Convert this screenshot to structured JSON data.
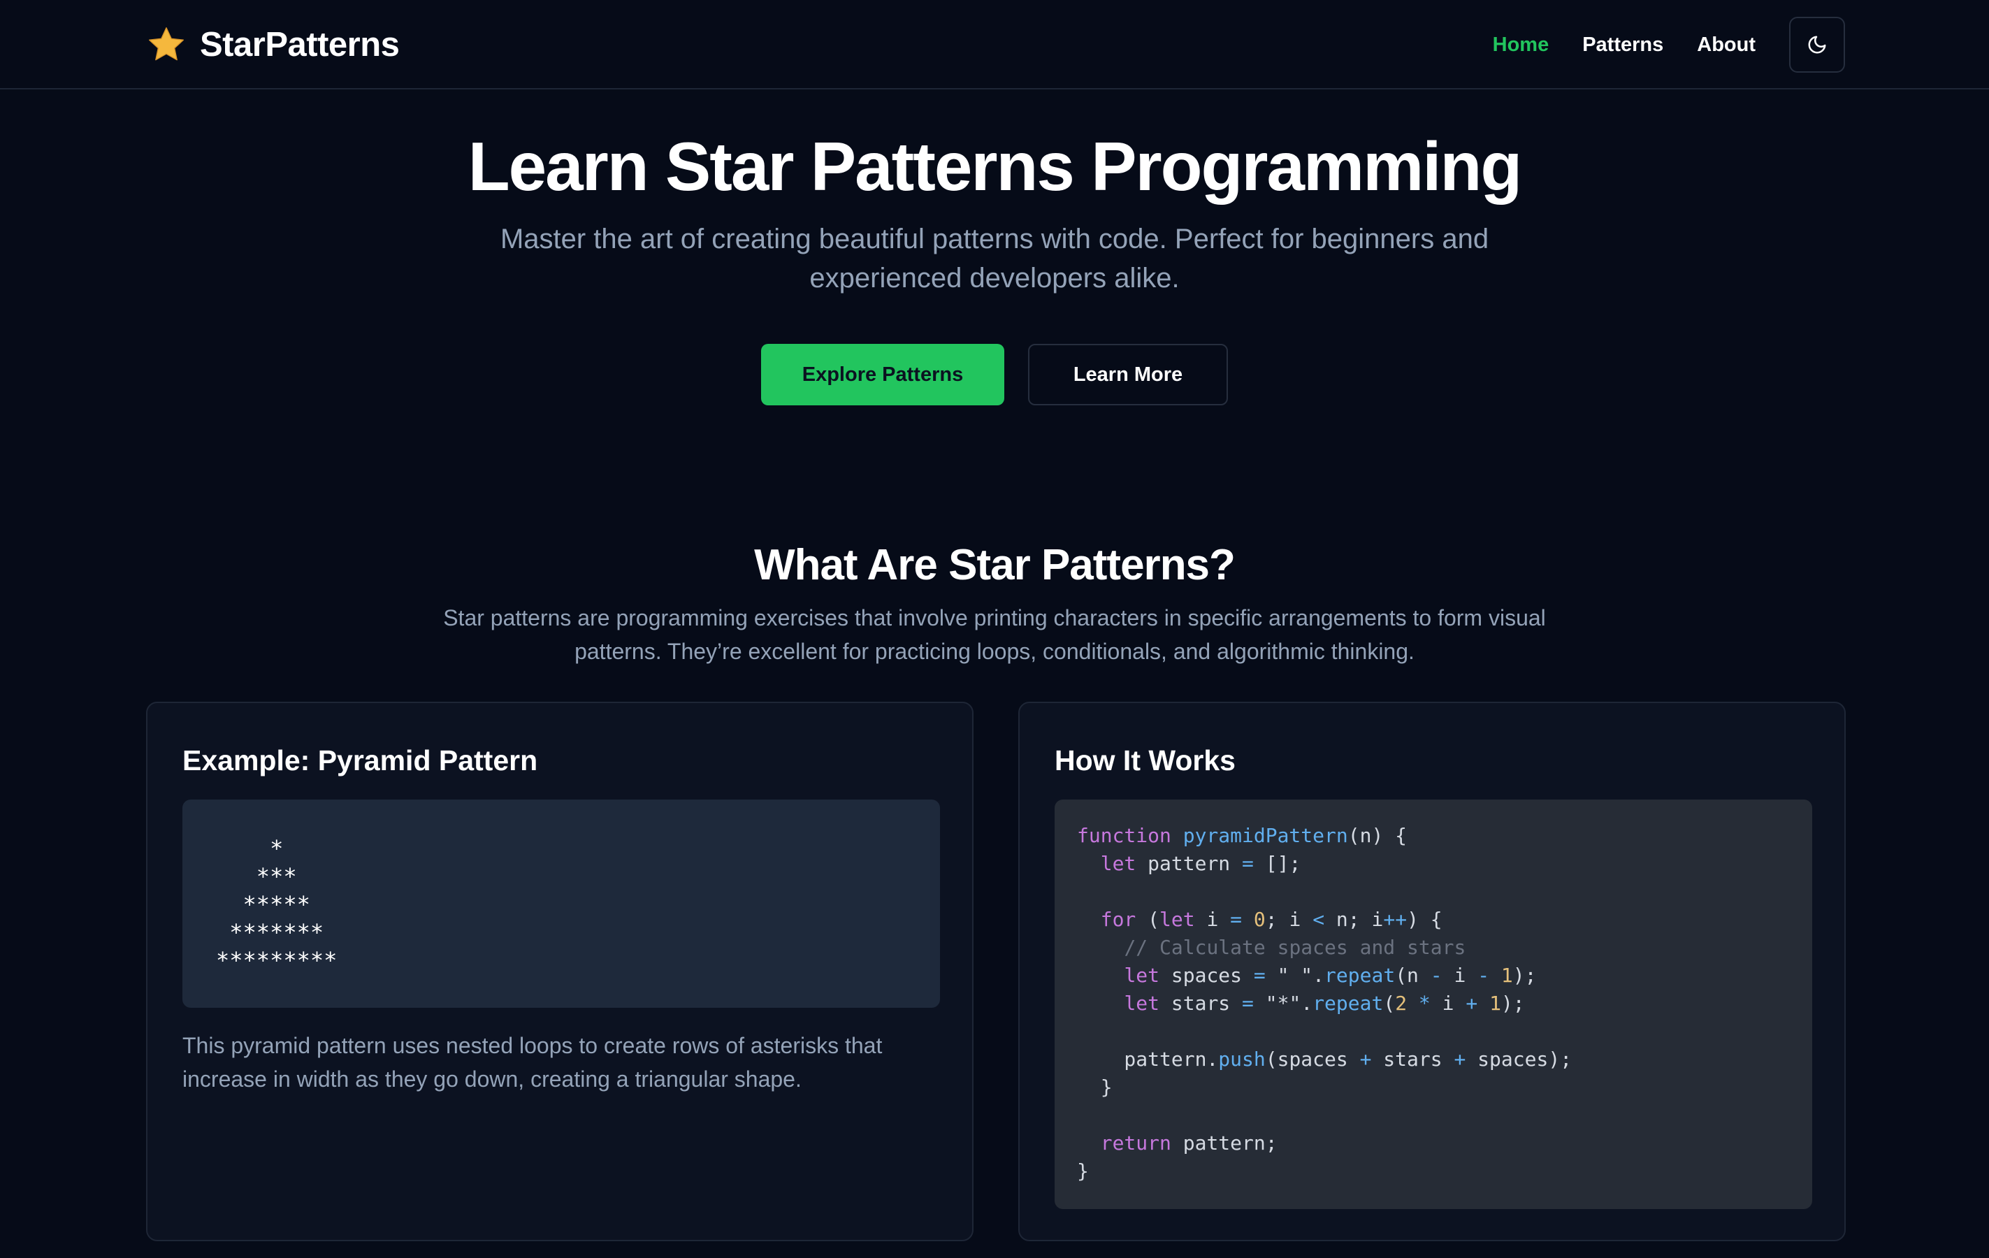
{
  "colors": {
    "accent": "#22c55e",
    "background": "#060b18",
    "card": "#0c1221",
    "muted_text": "#94a3b8"
  },
  "header": {
    "brand_icon": "star-icon",
    "brand_name": "StarPatterns",
    "nav": [
      {
        "label": "Home",
        "active": true
      },
      {
        "label": "Patterns",
        "active": false
      },
      {
        "label": "About",
        "active": false
      }
    ],
    "theme_toggle_icon": "moon-icon"
  },
  "hero": {
    "title": "Learn Star Patterns Programming",
    "subtitle": "Master the art of creating beautiful patterns with code. Perfect for beginners and experienced developers alike.",
    "primary_button": "Explore Patterns",
    "secondary_button": "Learn More"
  },
  "section": {
    "title": "What Are Star Patterns?",
    "description": "Star patterns are programming exercises that involve printing characters in specific arrangements to form visual patterns. They’re excellent for practicing loops, conditionals, and algorithmic thinking."
  },
  "example_card": {
    "title": "Example: Pyramid Pattern",
    "pattern_lines": [
      "    *",
      "   ***",
      "  *****",
      " *******",
      "*********"
    ],
    "description": "This pyramid pattern uses nested loops to create rows of asterisks that increase in width as they go down, creating a triangular shape."
  },
  "how_card": {
    "title": "How It Works",
    "code_lines": [
      "function pyramidPattern(n) {",
      "  let pattern = [];",
      "",
      "  for (let i = 0; i < n; i++) {",
      "    // Calculate spaces and stars",
      "    let spaces = \" \".repeat(n - i - 1);",
      "    let stars = \"*\".repeat(2 * i + 1);",
      "",
      "    pattern.push(spaces + stars + spaces);",
      "  }",
      "",
      "  return pattern;",
      "}"
    ]
  }
}
